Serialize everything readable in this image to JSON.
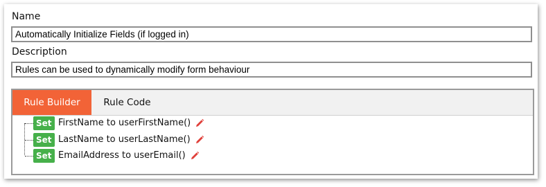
{
  "form": {
    "name_label": "Name",
    "name_value": "Automatically Initialize Fields (if logged in)",
    "description_label": "Description",
    "description_value": "Rules can be used to dynamically modify form behaviour"
  },
  "tabs": [
    {
      "label": "Rule Builder",
      "active": true
    },
    {
      "label": "Rule Code",
      "active": false
    }
  ],
  "rules": [
    {
      "action": "Set",
      "text": "FirstName to userFirstName()"
    },
    {
      "action": "Set",
      "text": "LastName to userLastName()"
    },
    {
      "action": "Set",
      "text": "EmailAddress to userEmail()"
    }
  ],
  "colors": {
    "active_tab": "#f26337",
    "badge": "#46b04a",
    "edit_icon": "#e0403a"
  },
  "icons": {
    "edit": "pencil-icon"
  }
}
